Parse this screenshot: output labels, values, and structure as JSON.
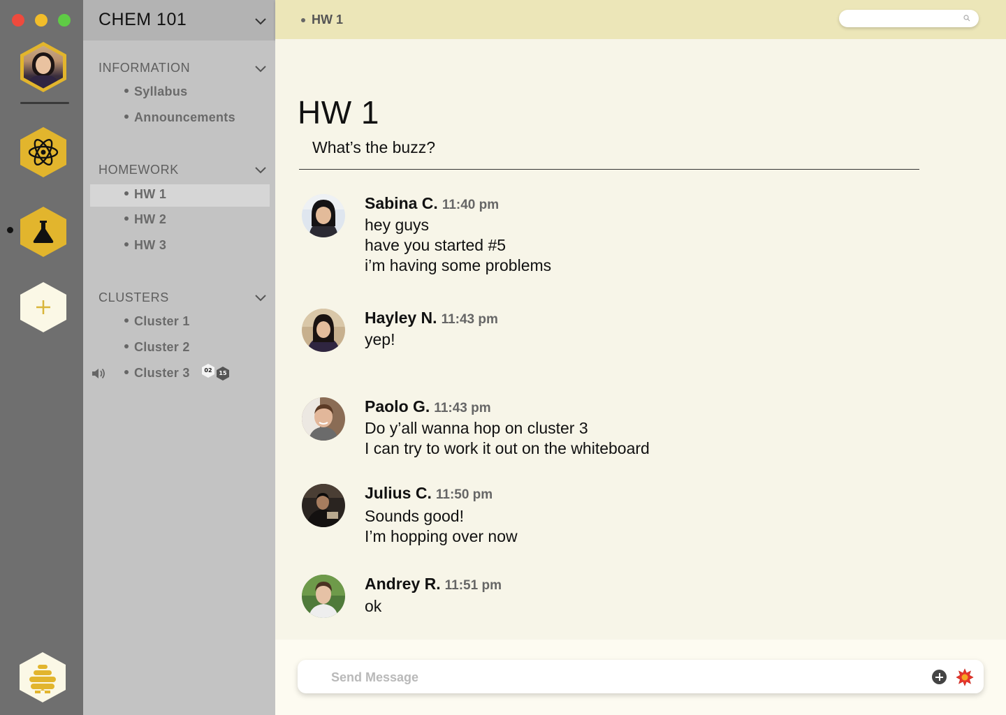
{
  "window": {
    "controls": [
      "close",
      "minimize",
      "maximize"
    ]
  },
  "rail": {
    "items": [
      {
        "name": "profile",
        "icon": "user-avatar-icon"
      },
      {
        "name": "physics",
        "icon": "atom-icon"
      },
      {
        "name": "chemistry",
        "icon": "flask-icon",
        "active": true
      },
      {
        "name": "add",
        "icon": "plus-icon"
      },
      {
        "name": "hive",
        "icon": "beehive-icon"
      }
    ],
    "accent": "#e2b52d"
  },
  "sidebar": {
    "course_title": "CHEM 101",
    "sections": [
      {
        "title": "INFORMATION",
        "items": [
          {
            "label": "Syllabus"
          },
          {
            "label": "Announcements"
          }
        ]
      },
      {
        "title": "HOMEWORK",
        "items": [
          {
            "label": "HW 1",
            "active": true
          },
          {
            "label": "HW 2"
          },
          {
            "label": "HW 3"
          }
        ]
      },
      {
        "title": "CLUSTERS",
        "items": [
          {
            "label": "Cluster 1"
          },
          {
            "label": "Cluster 2"
          },
          {
            "label": "Cluster 3",
            "voice": true,
            "badges": [
              "02",
              "15"
            ]
          }
        ]
      }
    ]
  },
  "topbar": {
    "breadcrumb": "HW 1",
    "search_placeholder": ""
  },
  "channel": {
    "title": "HW 1",
    "subtitle": "What’s the buzz?"
  },
  "messages": [
    {
      "author": "Sabina C.",
      "time": "11:40 pm",
      "lines": [
        "hey guys",
        "have you started #5",
        "i’m having some problems"
      ]
    },
    {
      "author": "Hayley N.",
      "time": "11:43 pm",
      "lines": [
        "yep!"
      ]
    },
    {
      "author": "Paolo G.",
      "time": "11:43 pm",
      "lines": [
        "Do y’all wanna hop on cluster 3",
        "I can try to work it out on the whiteboard"
      ]
    },
    {
      "author": "Julius C.",
      "time": "11:50 pm",
      "lines": [
        "Sounds good!",
        "I’m hopping over now"
      ]
    },
    {
      "author": "Andrey R.",
      "time": "11:51 pm",
      "lines": [
        "ok"
      ]
    }
  ],
  "composer": {
    "placeholder": "Send Message",
    "value": ""
  }
}
